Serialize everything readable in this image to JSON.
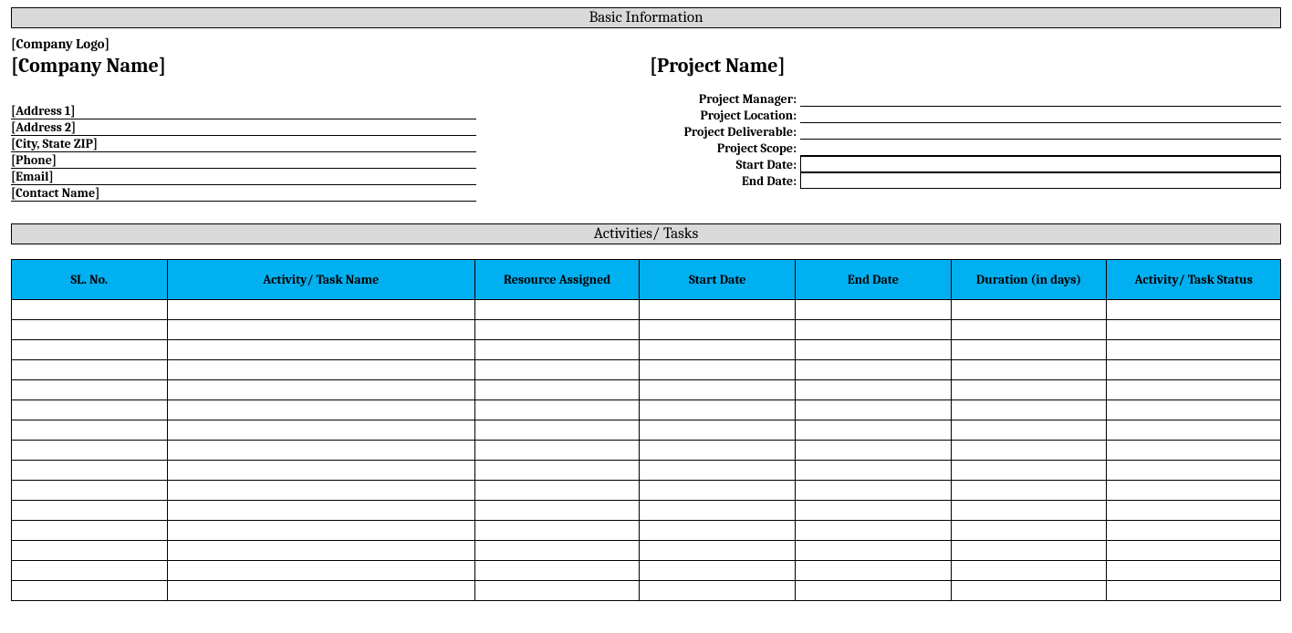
{
  "section1_title": "Basic Information",
  "company": {
    "logo_placeholder": "[Company Logo]",
    "name": "[Company Name]",
    "address1": "[Address 1]",
    "address2": "[Address 2]",
    "city_state_zip": "[City, State ZIP]",
    "phone": "[Phone]",
    "email": "[Email]",
    "contact_name": "[Contact Name]"
  },
  "project": {
    "name": "[Project Name]",
    "labels": {
      "manager": "Project Manager:",
      "location": "Project Location:",
      "deliverable": "Project Deliverable:",
      "scope": "Project Scope:",
      "start_date": "Start Date:",
      "end_date": "End Date:"
    },
    "values": {
      "manager": "",
      "location": "",
      "deliverable": "",
      "scope": "",
      "start_date": "",
      "end_date": ""
    }
  },
  "section2_title": "Activities/ Tasks",
  "activities": {
    "headers": {
      "sl_no": "SL. No.",
      "activity_name": "Activity/ Task Name",
      "resource": "Resource Assigned",
      "start_date": "Start Date",
      "end_date": "End Date",
      "duration": "Duration (in days)",
      "status": "Activity/ Task Status"
    },
    "rows": [
      {
        "sl": "",
        "name": "",
        "resource": "",
        "start": "",
        "end": "",
        "duration": "",
        "status": ""
      },
      {
        "sl": "",
        "name": "",
        "resource": "",
        "start": "",
        "end": "",
        "duration": "",
        "status": ""
      },
      {
        "sl": "",
        "name": "",
        "resource": "",
        "start": "",
        "end": "",
        "duration": "",
        "status": ""
      },
      {
        "sl": "",
        "name": "",
        "resource": "",
        "start": "",
        "end": "",
        "duration": "",
        "status": ""
      },
      {
        "sl": "",
        "name": "",
        "resource": "",
        "start": "",
        "end": "",
        "duration": "",
        "status": ""
      },
      {
        "sl": "",
        "name": "",
        "resource": "",
        "start": "",
        "end": "",
        "duration": "",
        "status": ""
      },
      {
        "sl": "",
        "name": "",
        "resource": "",
        "start": "",
        "end": "",
        "duration": "",
        "status": ""
      },
      {
        "sl": "",
        "name": "",
        "resource": "",
        "start": "",
        "end": "",
        "duration": "",
        "status": ""
      },
      {
        "sl": "",
        "name": "",
        "resource": "",
        "start": "",
        "end": "",
        "duration": "",
        "status": ""
      },
      {
        "sl": "",
        "name": "",
        "resource": "",
        "start": "",
        "end": "",
        "duration": "",
        "status": ""
      },
      {
        "sl": "",
        "name": "",
        "resource": "",
        "start": "",
        "end": "",
        "duration": "",
        "status": ""
      },
      {
        "sl": "",
        "name": "",
        "resource": "",
        "start": "",
        "end": "",
        "duration": "",
        "status": ""
      },
      {
        "sl": "",
        "name": "",
        "resource": "",
        "start": "",
        "end": "",
        "duration": "",
        "status": ""
      },
      {
        "sl": "",
        "name": "",
        "resource": "",
        "start": "",
        "end": "",
        "duration": "",
        "status": ""
      },
      {
        "sl": "",
        "name": "",
        "resource": "",
        "start": "",
        "end": "",
        "duration": "",
        "status": ""
      }
    ]
  }
}
